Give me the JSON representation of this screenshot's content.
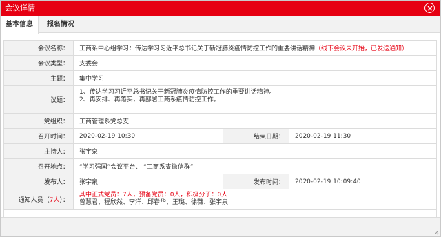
{
  "dialog": {
    "title": "会议详情",
    "close_icon": "close-icon"
  },
  "tabs": [
    {
      "label": "基本信息",
      "active": true
    },
    {
      "label": "报名情况",
      "active": false
    }
  ],
  "fields": {
    "name": {
      "label": "会议名称：",
      "value": "工商系中心组学习：传达学习习近平总书记关于新冠肺炎疫情防控工作的重要讲话精神",
      "status": "（线下会议未开始，已发送通知）"
    },
    "type": {
      "label": "会议类型：",
      "value": "支委会"
    },
    "topic": {
      "label": "主题：",
      "value": "集中学习"
    },
    "agenda": {
      "label": "议题：",
      "line1": "1、传达学习习近平总书记关于新冠肺炎疫情防控工作的重要讲话精神。",
      "line2": "2、再安排、再落实，再部署工商系疫情防控工作。"
    },
    "org": {
      "label": "党组织：",
      "value": "工商管理系党总支"
    },
    "start": {
      "label": "召开时间：",
      "value": "2020-02-19 10:30"
    },
    "end": {
      "label": "结束日期：",
      "value": "2020-02-19 11:30"
    },
    "host": {
      "label": "主持人：",
      "value": "张宇泉"
    },
    "place": {
      "label": "召开地点：",
      "value": "“学习强国”会议平台、 “工商系支微信群”"
    },
    "publisher": {
      "label": "发布人：",
      "value": "张宇泉"
    },
    "publish_time": {
      "label": "发布时间：",
      "value": "2020-02-19 10:09:40"
    },
    "notify": {
      "label_prefix": "通知人员（",
      "count": "7人",
      "label_suffix": "）：",
      "summary": "其中正式党员：7人，预备党员：0人，积极分子：0人",
      "names": "曾慧君、程欣然、李洋、邱春华、王璐、徐薇、张宇泉"
    }
  },
  "colors": {
    "accent": "#e60012",
    "label_bg": "#f2f2f2",
    "border": "#dcdcdc"
  }
}
